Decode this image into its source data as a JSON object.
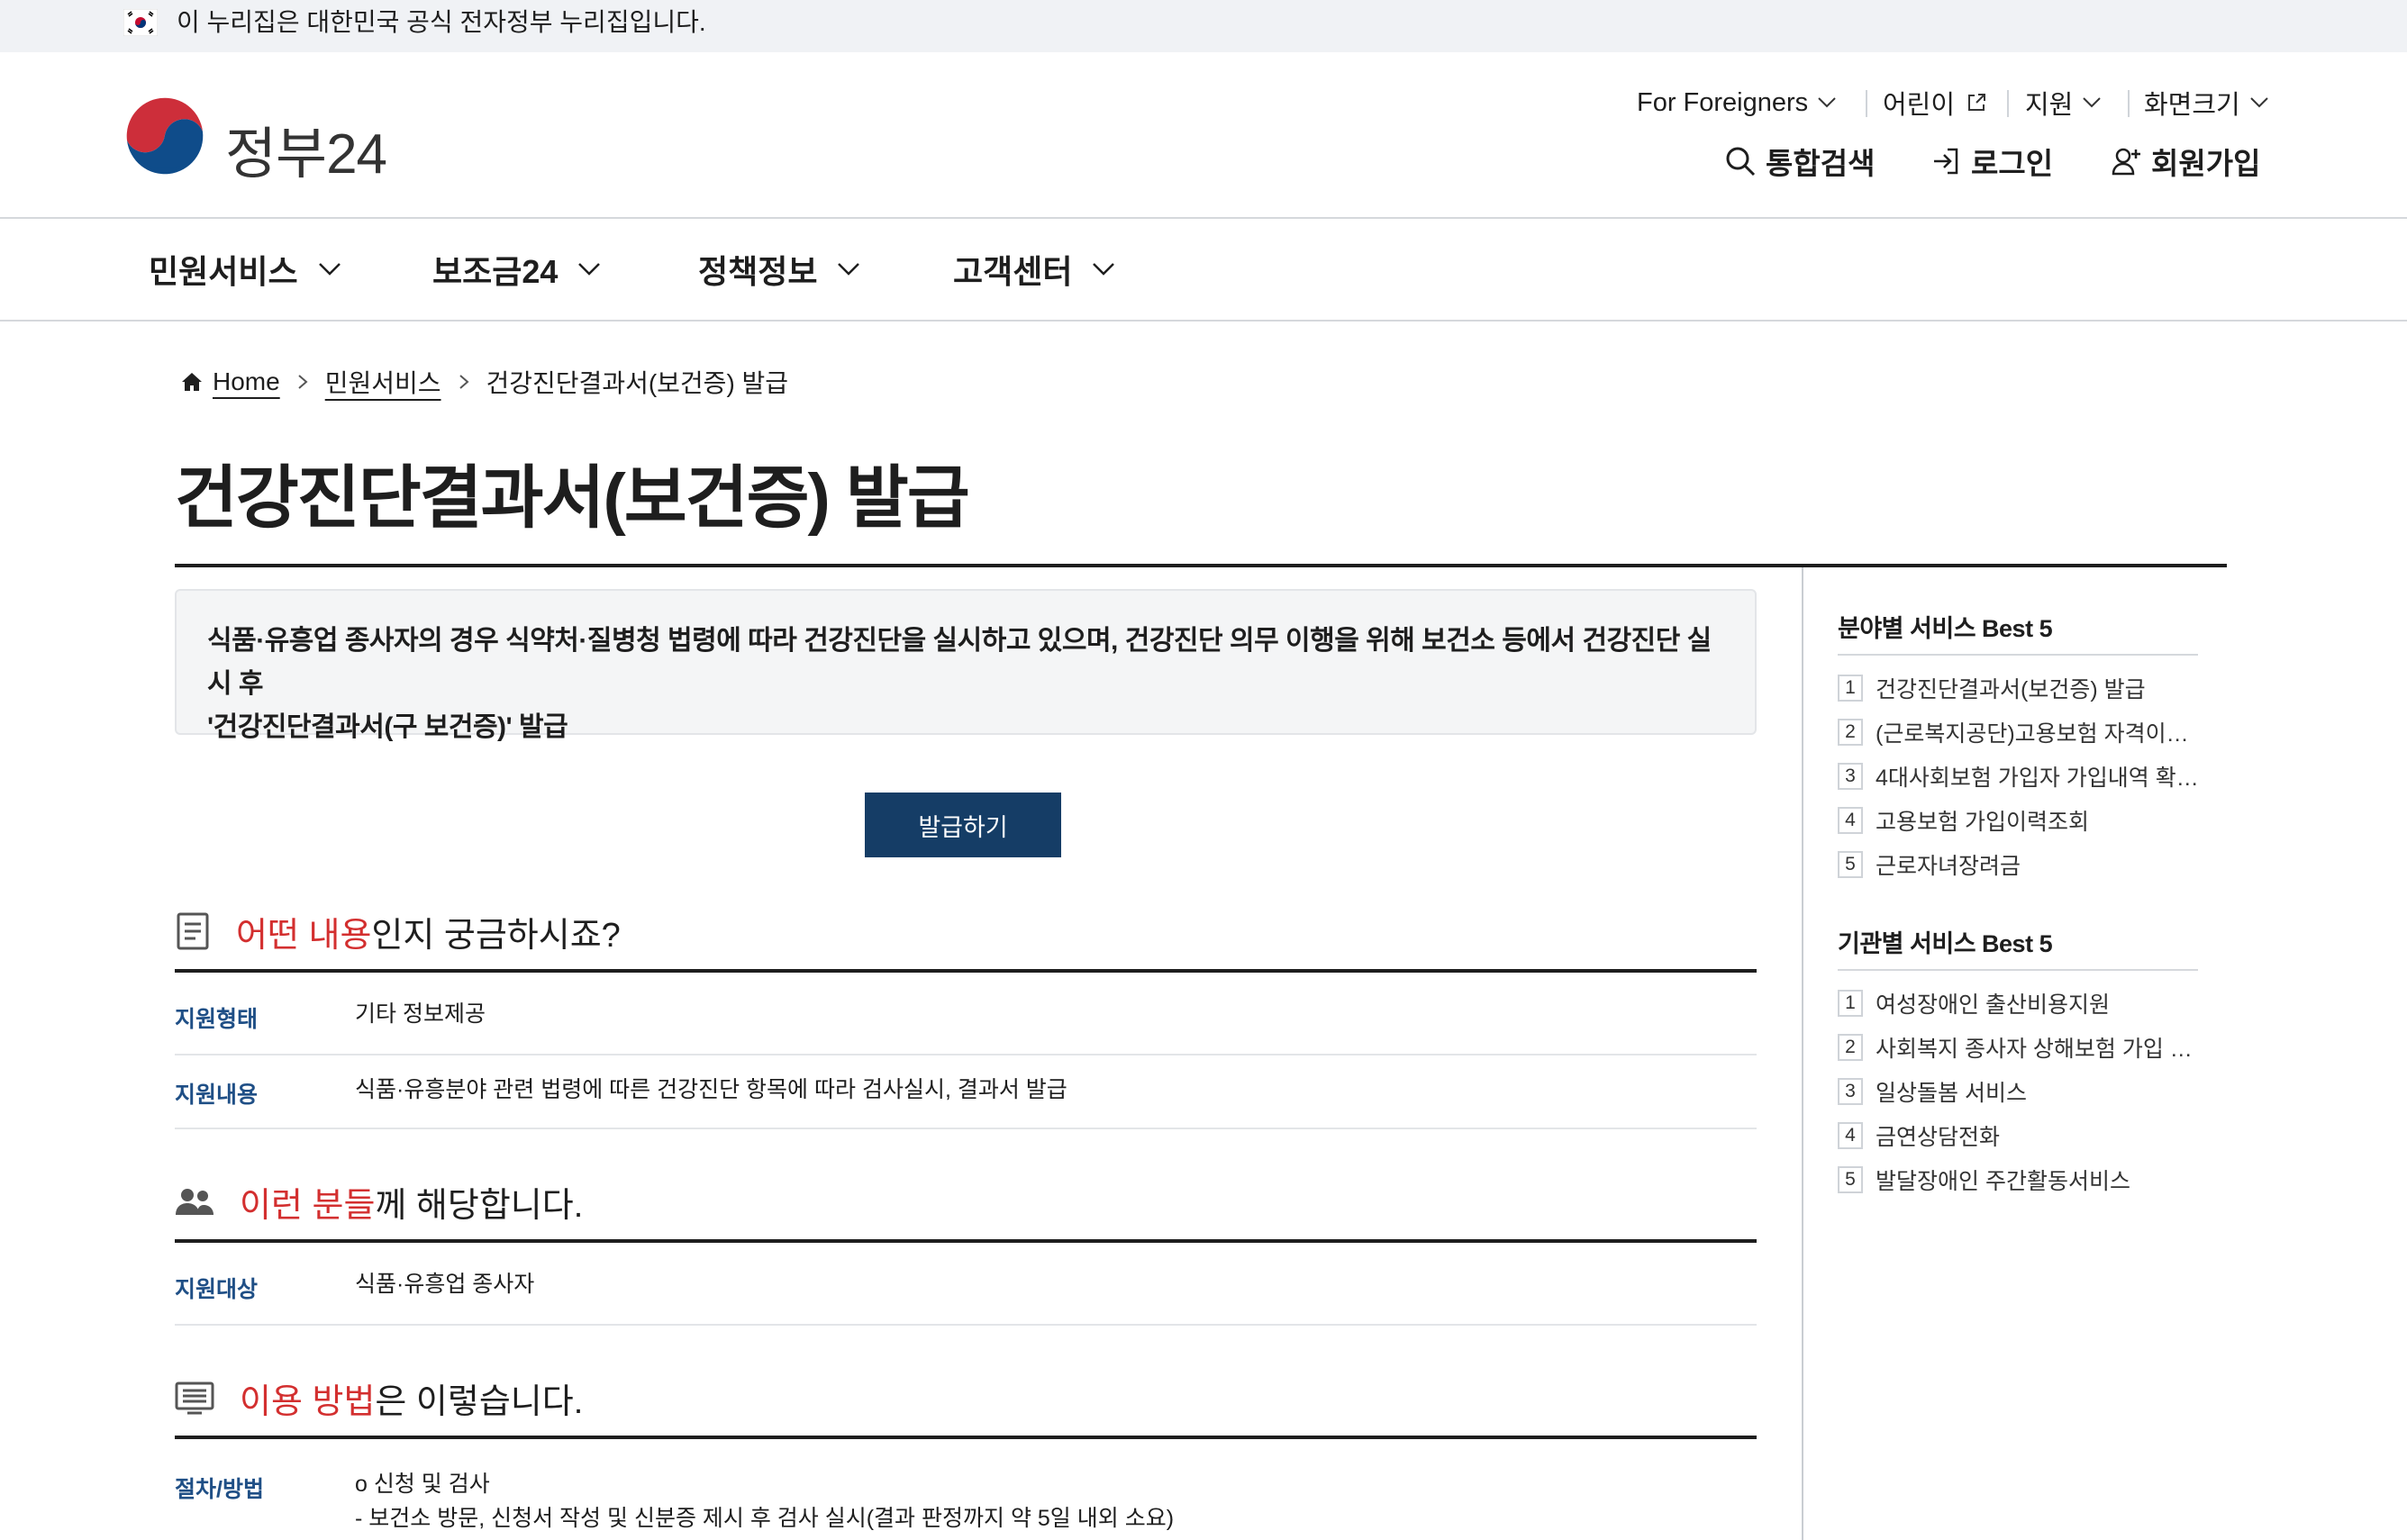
{
  "topbar": {
    "notice": "이 누리집은 대한민국 공식 전자정부 누리집입니다."
  },
  "header": {
    "logo_text": "정부24",
    "util": {
      "foreigners": "For Foreigners",
      "kids": "어린이",
      "support": "지원",
      "screen_size": "화면크기"
    },
    "actions": {
      "search": "통합검색",
      "login": "로그인",
      "signup": "회원가입"
    }
  },
  "nav": {
    "items": [
      "민원서비스",
      "보조금24",
      "정책정보",
      "고객센터"
    ]
  },
  "breadcrumb": {
    "home": "Home",
    "level1": "민원서비스",
    "current": "건강진단결과서(보건증) 발급"
  },
  "page": {
    "title": "건강진단결과서(보건증) 발급",
    "summary_line1": "식품·유흥업 종사자의 경우 식약처·질병청 법령에 따라 건강진단을 실시하고 있으며, 건강진단 의무 이행을 위해 보건소 등에서 건강진단 실시 후",
    "summary_line2": "'건강진단결과서(구 보건증)' 발급",
    "issue_button": "발급하기"
  },
  "sections": {
    "what": {
      "accent": "어떤 내용",
      "rest": "인지 궁금하시죠?"
    },
    "who": {
      "accent": "이런 분들",
      "rest": "께 해당합니다."
    },
    "how": {
      "accent": "이용 방법",
      "rest": "은 이렇습니다."
    }
  },
  "details": {
    "support_type_label": "지원형태",
    "support_type_value": "기타  정보제공",
    "support_content_label": "지원내용",
    "support_content_value": "식품·유흥분야 관련 법령에 따른 건강진단 항목에 따라 검사실시, 결과서 발급",
    "target_label": "지원대상",
    "target_value": "식품·유흥업 종사자",
    "procedure_label": "절차/방법",
    "procedure_line1": "o 신청 및 검사",
    "procedure_line2": " - 보건소 방문, 신청서 작성 및 신분증 제시 후 검사 실시(결과 판정까지 약 5일 내외 소요)"
  },
  "sidebar": {
    "field_title": "분야별 서비스 Best 5",
    "field_items": [
      "건강진단결과서(보건증) 발급",
      "(근로복지공단)고용보험 자격이…",
      "4대사회보험 가입자 가입내역 확…",
      "고용보험 가입이력조회",
      "근로자녀장려금"
    ],
    "org_title": "기관별 서비스 Best 5",
    "org_items": [
      "여성장애인 출산비용지원",
      "사회복지 종사자 상해보험 가입 …",
      "일상돌봄 서비스",
      "금연상담전화",
      "발달장애인 주간활동서비스"
    ],
    "numbers": [
      "1",
      "2",
      "3",
      "4",
      "5"
    ]
  },
  "colors": {
    "accent_red": "#d32f2f",
    "button_navy": "#153d66",
    "label_blue": "#1f4f86"
  }
}
